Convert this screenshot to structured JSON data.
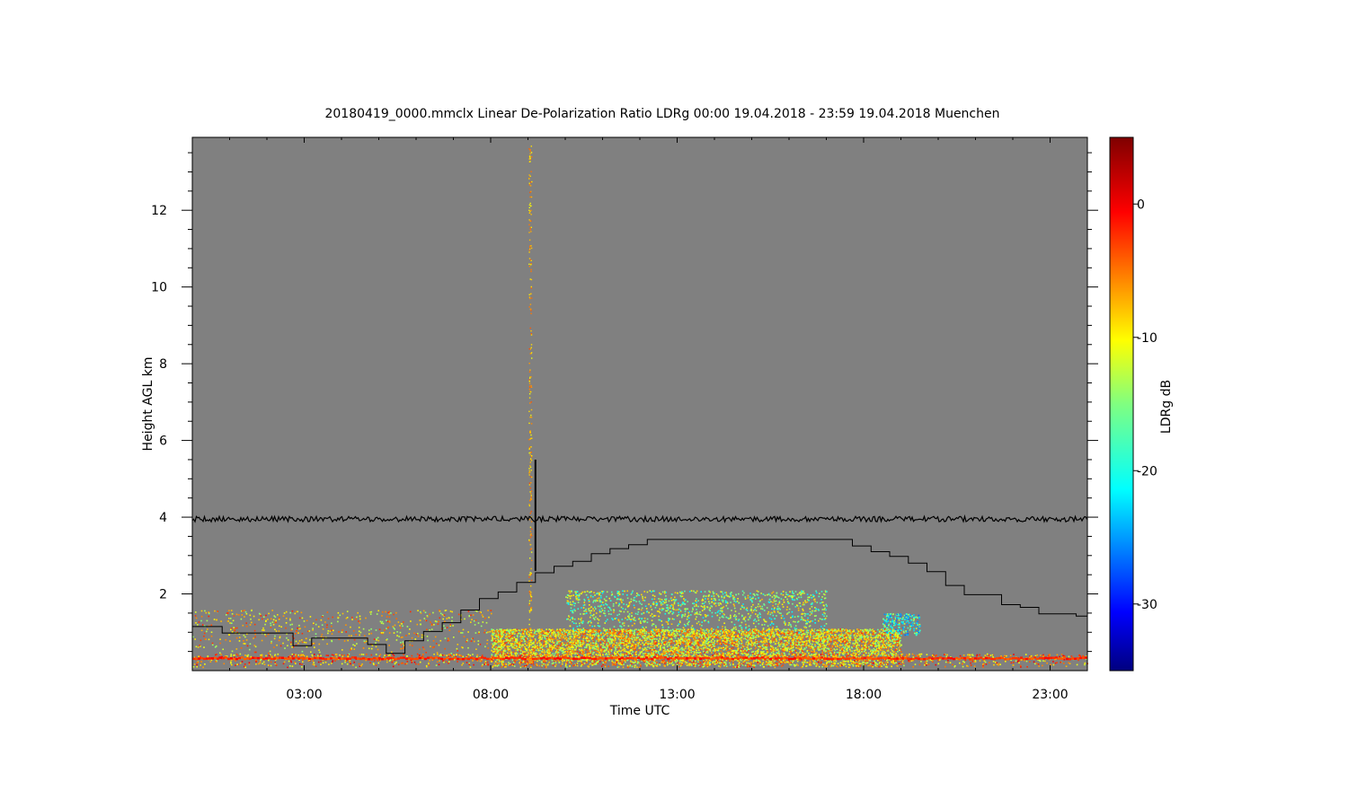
{
  "chart_data": {
    "type": "heatmap",
    "title": "20180419_0000.mmclx Linear De-Polarization Ratio LDRg   00:00 19.04.2018 - 23:59 19.04.2018 Muenchen",
    "xlabel": "Time UTC",
    "ylabel": "Height AGL km",
    "xlim": [
      0,
      24
    ],
    "ylim": [
      0,
      13.9
    ],
    "x_ticks": [
      {
        "value": 3,
        "label": "03:00"
      },
      {
        "value": 8,
        "label": "08:00"
      },
      {
        "value": 13,
        "label": "13:00"
      },
      {
        "value": 18,
        "label": "18:00"
      },
      {
        "value": 23,
        "label": "23:00"
      }
    ],
    "y_ticks": [
      {
        "value": 2,
        "label": "2"
      },
      {
        "value": 4,
        "label": "4"
      },
      {
        "value": 6,
        "label": "6"
      },
      {
        "value": 8,
        "label": "8"
      },
      {
        "value": 10,
        "label": "10"
      },
      {
        "value": 12,
        "label": "12"
      }
    ],
    "colorbar": {
      "label": "LDRg dB",
      "range": [
        -35,
        5
      ],
      "ticks": [
        {
          "value": 0,
          "label": "0"
        },
        {
          "value": -10,
          "label": "-10"
        },
        {
          "value": -20,
          "label": "-20"
        },
        {
          "value": -30,
          "label": "-30"
        }
      ],
      "colormap": "jet"
    },
    "background_color": "#808080",
    "reference_line": {
      "height_km": 3.95,
      "color": "#000000",
      "noise": true
    },
    "spike": {
      "time": 9.2,
      "height_from": 2.6,
      "height_to": 5.5
    },
    "vertical_streak": {
      "time": 9.05,
      "height_from": 0.1,
      "height_to": 13.7
    },
    "step_series": {
      "name": "",
      "color": "#000000",
      "times": [
        0,
        0.8,
        2.2,
        2.7,
        3.2,
        4.7,
        5.2,
        5.7,
        6.2,
        6.7,
        7.2,
        7.7,
        8.2,
        8.7,
        9.2,
        9.7,
        10.2,
        10.7,
        11.2,
        11.7,
        12.2,
        16.7,
        17.7,
        18.2,
        18.7,
        19.2,
        19.7,
        20.2,
        20.7,
        21.7,
        22.2,
        22.7,
        23.7,
        24
      ],
      "heights": [
        1.15,
        0.98,
        0.98,
        0.65,
        0.85,
        0.68,
        0.45,
        0.78,
        1.02,
        1.25,
        1.58,
        1.88,
        2.05,
        2.3,
        2.55,
        2.72,
        2.85,
        3.05,
        3.18,
        3.28,
        3.42,
        3.42,
        3.25,
        3.1,
        2.98,
        2.8,
        2.58,
        2.22,
        1.98,
        1.72,
        1.65,
        1.48,
        1.42,
        1.3
      ]
    },
    "echo_regions": [
      {
        "t0": 0,
        "t1": 24,
        "h0": 0.1,
        "h1": 0.45,
        "dbz_mean": -6,
        "density": 0.25
      },
      {
        "t0": 8,
        "t1": 19,
        "h0": 0.1,
        "h1": 1.1,
        "dbz_mean": -9,
        "density": 0.9
      },
      {
        "t0": 10,
        "t1": 17,
        "h0": 1.0,
        "h1": 2.1,
        "dbz_mean": -14,
        "density": 0.25
      },
      {
        "t0": 18.5,
        "t1": 19.5,
        "h0": 0.9,
        "h1": 1.5,
        "dbz_mean": -19,
        "density": 0.6
      },
      {
        "t0": 0,
        "t1": 8,
        "h0": 0.4,
        "h1": 1.6,
        "dbz_mean": -8,
        "density": 0.1
      }
    ],
    "surface_line": {
      "height_km": 0.35,
      "dbz": -2,
      "t0": 0,
      "t1": 24
    }
  }
}
